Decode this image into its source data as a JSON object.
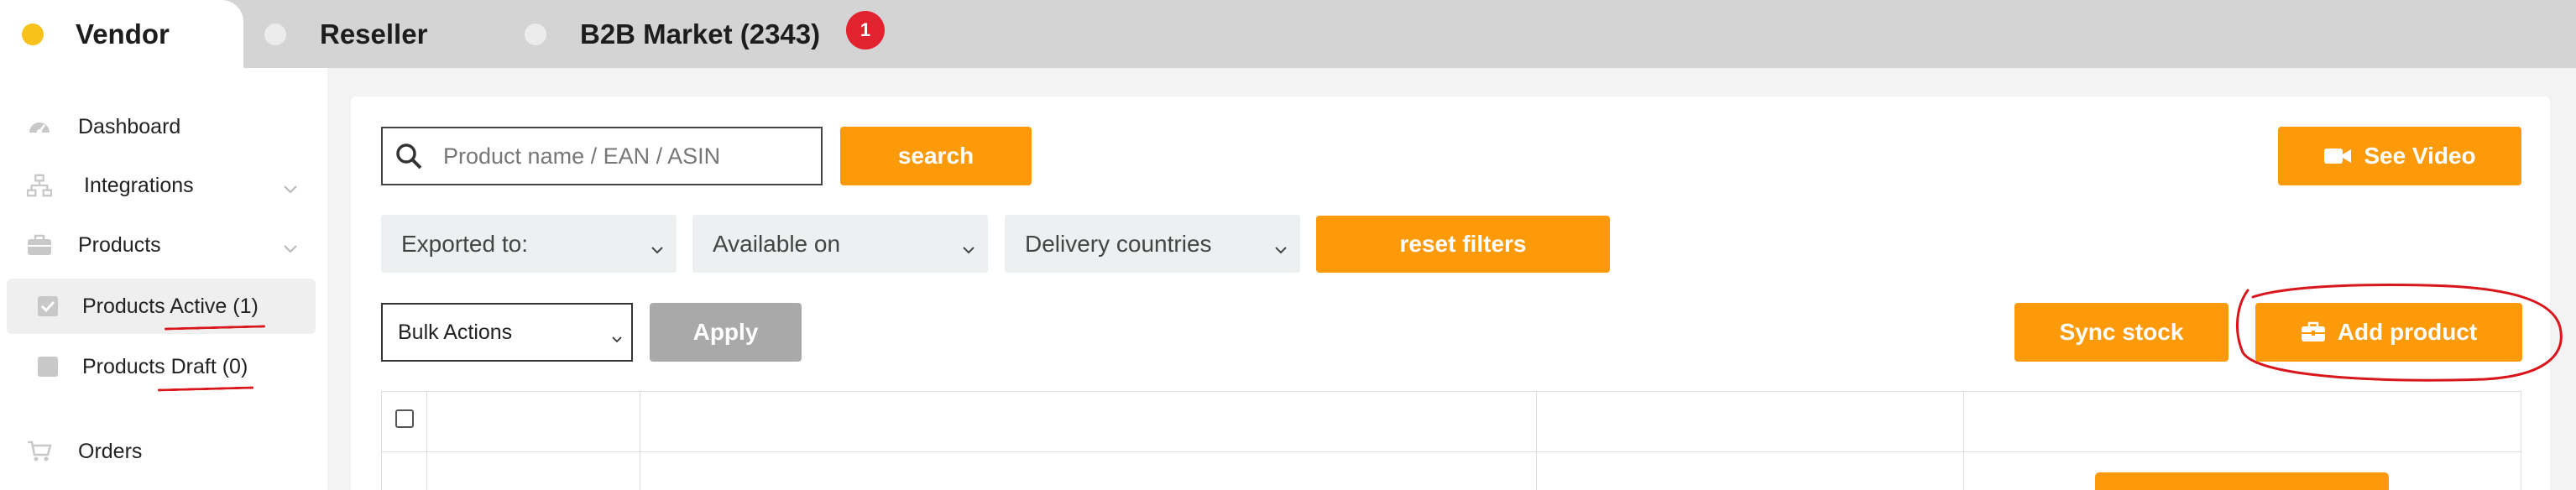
{
  "tabs": [
    {
      "label": "Vendor",
      "active": true
    },
    {
      "label": "Reseller",
      "active": false
    },
    {
      "label": "B2B Market (2343)",
      "active": false,
      "badge": "1"
    }
  ],
  "sidebar": {
    "items": [
      {
        "label": "Dashboard",
        "icon": "dashboard-icon"
      },
      {
        "label": "Integrations",
        "icon": "sitemap-icon",
        "expandable": true
      },
      {
        "label": "Products",
        "icon": "briefcase-icon",
        "expandable": true
      },
      {
        "label": "Products Active (1)",
        "icon": "checkbox-checked-icon",
        "active": true
      },
      {
        "label": "Products Draft (0)",
        "icon": "checkbox-empty-icon"
      },
      {
        "label": "Orders",
        "icon": "cart-icon"
      }
    ]
  },
  "toolbar": {
    "search_placeholder": "Product name / EAN / ASIN",
    "search_label": "search",
    "video_label": "See Video",
    "filters": {
      "exported_to": "Exported to:",
      "available_on": "Available on",
      "delivery_countries": "Delivery countries"
    },
    "reset_label": "reset filters",
    "bulk_actions": "Bulk Actions",
    "apply_label": "Apply",
    "sync_label": "Sync stock",
    "add_label": "Add product"
  },
  "colors": {
    "accent": "#fd9a0a",
    "badge": "#e3222f",
    "annotation": "#d9161b"
  }
}
